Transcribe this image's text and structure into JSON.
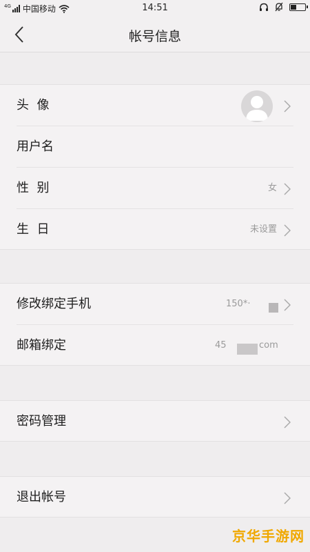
{
  "status_bar": {
    "network_type": "4G",
    "carrier": "中国移动",
    "time": "14:51"
  },
  "header": {
    "title": "帐号信息"
  },
  "rows": {
    "avatar": {
      "label": "头  像"
    },
    "username": {
      "label": "用户名"
    },
    "gender": {
      "label": "性  别",
      "value": "女"
    },
    "birthday": {
      "label": "生  日",
      "value": "未设置"
    },
    "phone": {
      "label": "修改绑定手机",
      "value": "150*·"
    },
    "email": {
      "label": "邮箱绑定",
      "value_prefix": "45",
      "value_suffix": "com"
    },
    "password": {
      "label": "密码管理"
    },
    "logout": {
      "label": "退出帐号"
    }
  },
  "watermark": "京华手游网",
  "colors": {
    "background": "#efedee",
    "row_background": "#f4f2f3",
    "secondary_text": "#9a9a9a",
    "chevron": "#a9a9a9",
    "watermark": "#f0a800"
  },
  "icons": [
    "back-arrow-icon",
    "signal-icon",
    "wifi-icon",
    "headset-icon",
    "mute-icon",
    "battery-icon",
    "chevron-right-icon",
    "default-avatar-icon"
  ]
}
